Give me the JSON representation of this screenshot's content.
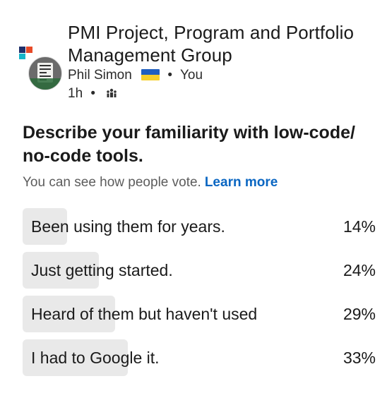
{
  "post": {
    "group_name": "PMI Project, Program and Portfolio Management Group",
    "author": "Phil Simon",
    "author_flag_icon": "ukraine-flag-icon",
    "relation": "You",
    "time_ago": "1h",
    "separator": "•",
    "audience_icon": "group-icon",
    "group_logo_text": "PMI"
  },
  "poll": {
    "question": "Describe your familiarity with low-code/ no-code tools.",
    "visibility_notice": "You can see how people vote.",
    "learn_more": "Learn more",
    "bar_color": "#e9e9e9",
    "link_color": "#0a66c2",
    "options": [
      {
        "label": "Been using them for years.",
        "percent_text": "14%",
        "percent": 14
      },
      {
        "label": "Just getting started.",
        "percent_text": "24%",
        "percent": 24
      },
      {
        "label": "Heard of them but haven't used",
        "percent_text": "29%",
        "percent": 29
      },
      {
        "label": "I had to Google it.",
        "percent_text": "33%",
        "percent": 33
      }
    ]
  }
}
